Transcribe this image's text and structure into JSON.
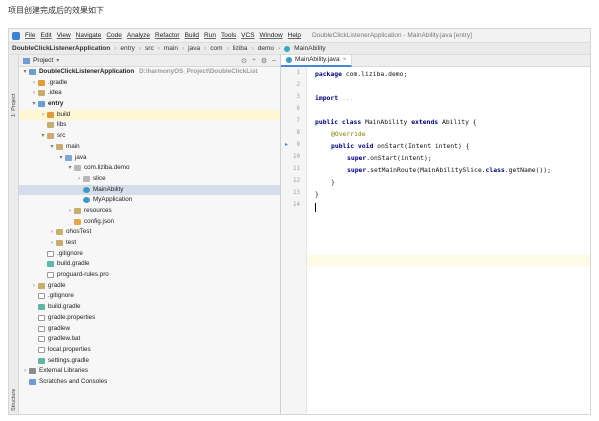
{
  "caption": "项目创建完成后的效果如下",
  "menubar": {
    "items": [
      "File",
      "Edit",
      "View",
      "Navigate",
      "Code",
      "Analyze",
      "Refactor",
      "Build",
      "Run",
      "Tools",
      "VCS",
      "Window",
      "Help"
    ],
    "window_title": "DoubleClickListenerApplication - MainAbility.java [entry]"
  },
  "navbar": {
    "crumbs": [
      "DoubleClickListenerApplication",
      "entry",
      "src",
      "main",
      "java",
      "com",
      "liziba",
      "demo",
      "MainAbility"
    ]
  },
  "side_strip": {
    "top_label": "1: Project",
    "bottom_label": "Structure"
  },
  "project_panel": {
    "title": "Project",
    "tree": [
      {
        "label": "DoubleClickListenerApplication",
        "path": "D:\\harmonyOS_Project\\DoubleClickList"
      },
      {
        "label": ".gradle"
      },
      {
        "label": ".idea"
      },
      {
        "label": "entry"
      },
      {
        "label": "build"
      },
      {
        "label": "libs"
      },
      {
        "label": "src"
      },
      {
        "label": "main"
      },
      {
        "label": "java"
      },
      {
        "label": "com.liziba.demo"
      },
      {
        "label": "slice"
      },
      {
        "label": "MainAbility"
      },
      {
        "label": "MyApplication"
      },
      {
        "label": "resources"
      },
      {
        "label": "config.json"
      },
      {
        "label": "ohosTest"
      },
      {
        "label": "test"
      },
      {
        "label": ".gitignore"
      },
      {
        "label": "build.gradle"
      },
      {
        "label": "proguard-rules.pro"
      },
      {
        "label": "gradle"
      },
      {
        "label": ".gitignore"
      },
      {
        "label": "build.gradle"
      },
      {
        "label": "gradle.properties"
      },
      {
        "label": "gradlew"
      },
      {
        "label": "gradlew.bat"
      },
      {
        "label": "local.properties"
      },
      {
        "label": "settings.gradle"
      },
      {
        "label": "External Libraries"
      },
      {
        "label": "Scratches and Consoles"
      }
    ]
  },
  "editor": {
    "tab_label": "MainAbility.java",
    "line_numbers": [
      "1",
      "2",
      "3",
      "6",
      "7",
      "8",
      "9",
      "10",
      "11",
      "12",
      "13",
      "14"
    ],
    "lines": [
      {
        "kw": "package",
        "rest": " com.liziba.demo;"
      },
      {
        "kw": "",
        "rest": ""
      },
      {
        "kw": "import",
        "rest": " ..."
      },
      {
        "kw": "",
        "rest": ""
      },
      {
        "kw": "public class",
        "rest": " MainAbility ",
        "kw2": "extends",
        "rest2": " Ability {"
      },
      {
        "ann": "@Override"
      },
      {
        "kw": "public void",
        "rest": " onStart(Intent intent) {"
      },
      {
        "kw": "super",
        "rest": ".onStart(intent);"
      },
      {
        "kw": "super",
        "rest": ".setMainRoute(MainAbilitySlice.",
        "kw2": "class",
        "rest2": ".getName());"
      },
      {
        "kw": "",
        "rest": "}"
      },
      {
        "kw": "",
        "rest": "}"
      },
      {
        "kw": "",
        "rest": ""
      }
    ]
  }
}
